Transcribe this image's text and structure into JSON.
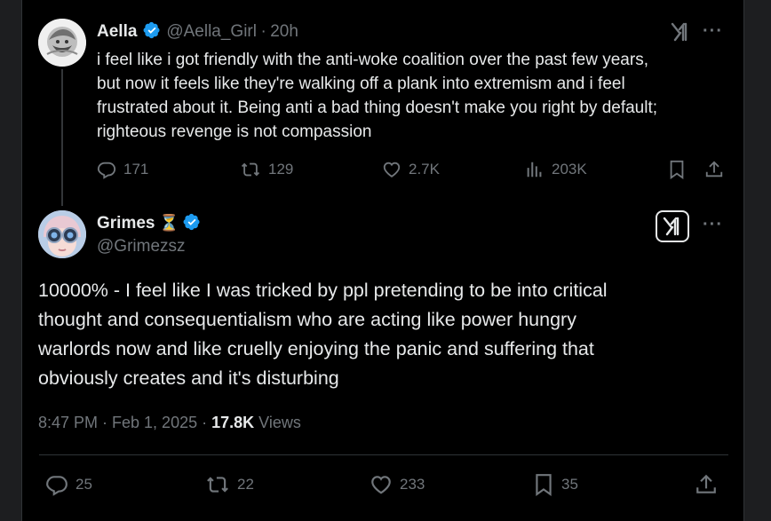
{
  "reply_to": {
    "name": "Aella",
    "handle": "@Aella_Girl",
    "sep": "·",
    "time": "20h",
    "text": "i feel like i got friendly with the anti-woke coalition over the past few years,\nbut now it feels like they're walking off a plank into extremism and i feel\nfrustrated about it. Being anti a bad thing doesn't make you right by default;\nrighteous revenge is not compassion",
    "replies": "171",
    "reposts": "129",
    "likes": "2.7K",
    "views": "203K"
  },
  "main_tweet": {
    "name": "Grimes",
    "name_emoji": "⏳",
    "handle": "@Grimezsz",
    "text": "10000% - I feel like I was tricked by ppl pretending to be into critical\nthought and consequentialism who are acting like power hungry\nwarlords now and like cruelly enjoying the panic and suffering that\nobviously creates and it's disturbing",
    "timestamp": "8:47 PM · Feb 1, 2025 · ",
    "views_count": "17.8K",
    "views_label": " Views",
    "replies": "25",
    "reposts": "22",
    "likes": "233",
    "bookmarks": "35"
  },
  "colors": {
    "background": "#000000",
    "text": "#e7e9ea",
    "secondary": "#71767b",
    "verified": "#1d9bf0",
    "border": "#2f3336"
  },
  "icons": [
    "verified-badge-icon",
    "grok-icon",
    "more-icon",
    "reply-icon",
    "repost-icon",
    "like-icon",
    "views-icon",
    "bookmark-icon",
    "share-icon"
  ]
}
